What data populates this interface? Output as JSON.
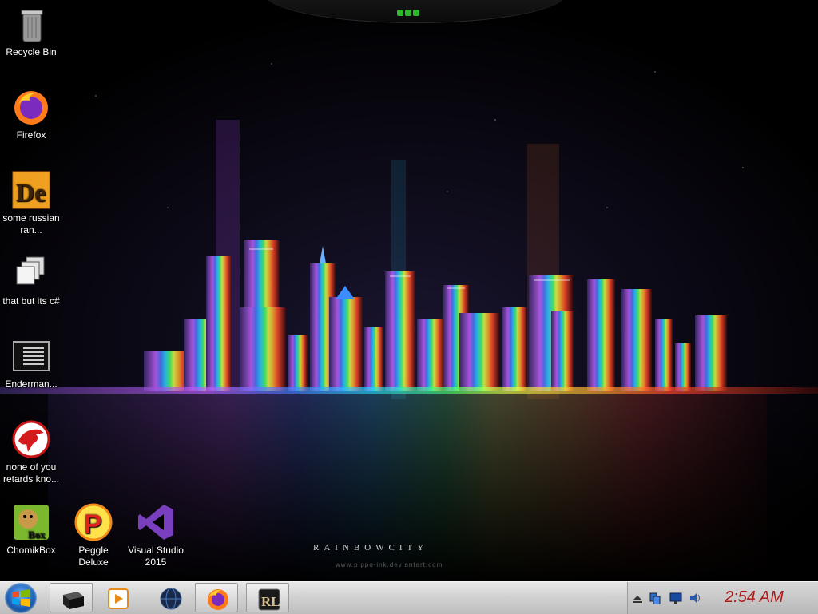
{
  "wallpaper": {
    "title": "RAINBOWCITY",
    "credit": "www.pippo-ink.deviantart.com"
  },
  "desktop_icons": [
    {
      "label": "Recycle Bin",
      "icon": "recycle-bin-icon"
    },
    {
      "label": "Firefox",
      "icon": "firefox-icon"
    },
    {
      "label": "some russian ran...",
      "icon": "de-app-icon"
    },
    {
      "label": "that but its c#",
      "icon": "windows-stack-icon"
    },
    {
      "label": "Enderman...",
      "icon": "console-icon"
    },
    {
      "label": "none of you retards kno...",
      "icon": "red-dragon-icon"
    },
    {
      "label": "ChomikBox",
      "icon": "chomikbox-icon"
    },
    {
      "label": "Peggle Deluxe",
      "icon": "peggle-icon"
    },
    {
      "label": "Visual Studio 2015",
      "icon": "visual-studio-icon"
    }
  ],
  "taskbar": {
    "start_icon": "windows-orb-icon",
    "pinned": [
      "black-box-icon",
      "media-player-icon",
      "globe-icon",
      "firefox-icon",
      "rl-app-icon"
    ],
    "tray_icons": [
      "show-hidden-icon",
      "network-icon",
      "display-icon",
      "volume-icon"
    ],
    "clock": "2:54 AM"
  },
  "colors": {
    "clock": "#b01818",
    "taskbar": "#d2d2d2"
  }
}
